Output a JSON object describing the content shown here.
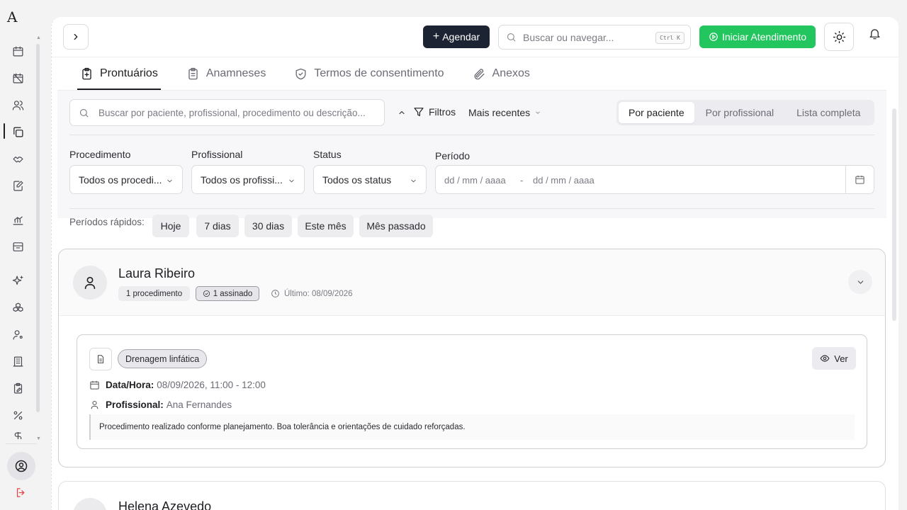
{
  "sidebar": {
    "logo": "A",
    "icons": [
      "calendar-icon",
      "calendar-off-icon",
      "users-icon",
      "copy-files-icon",
      "handshake-icon",
      "edit-document-icon",
      "chart-icon",
      "inbox-icon",
      "sparkles-icon",
      "boxes-icon",
      "user-settings-icon",
      "building-icon",
      "clipboard-edit-icon",
      "percent-icon",
      "dollar-icon"
    ],
    "active": "copy-files-icon"
  },
  "topbar": {
    "agendar_label": "Agendar",
    "search_placeholder": "Buscar ou navegar...",
    "search_shortcut": "Ctrl K",
    "iniciar_label": "Iniciar Atendimento"
  },
  "tabs": [
    {
      "label": "Prontuários",
      "icon": "clipboard-plus-icon",
      "active": true
    },
    {
      "label": "Anamneses",
      "icon": "clipboard-list-icon",
      "active": false
    },
    {
      "label": "Termos de consentimento",
      "icon": "shield-check-icon",
      "active": false
    },
    {
      "label": "Anexos",
      "icon": "paperclip-icon",
      "active": false
    }
  ],
  "filters": {
    "search_placeholder": "Buscar por paciente, profissional, procedimento ou descrição...",
    "filtros_label": "Filtros",
    "sort_label": "Mais recentes",
    "view_modes": [
      "Por paciente",
      "Por profissional",
      "Lista completa"
    ],
    "view_active": "Por paciente",
    "procedimento_label": "Procedimento",
    "procedimento_value": "Todos os procedi...",
    "profissional_label": "Profissional",
    "profissional_value": "Todos os profissi...",
    "status_label": "Status",
    "status_value": "Todos os status",
    "periodo_label": "Período",
    "date_from_placeholder": "dd / mm / aaaa",
    "date_sep": "-",
    "date_to_placeholder": "dd / mm / aaaa",
    "quick_label": "Períodos rápidos:",
    "quick_periods": [
      "Hoje",
      "7 dias",
      "30 dias",
      "Este mês",
      "Mês passado"
    ]
  },
  "patients": [
    {
      "name": "Laura Ribeiro",
      "procedures_badge": "1 procedimento",
      "signed_badge": "1 assinado",
      "last": "Último: 08/09/2026",
      "record": {
        "procedure": "Drenagem linfática",
        "ver_label": "Ver",
        "datetime_key": "Data/Hora:",
        "datetime_value": "08/09/2026, 11:00 - 12:00",
        "prof_key": "Profissional:",
        "prof_value": "Ana Fernandes",
        "note": "Procedimento realizado conforme planejamento. Boa tolerância e orientações de cuidado reforçadas."
      }
    },
    {
      "name": "Helena Azevedo"
    }
  ],
  "colors": {
    "primary_dark": "#1c2333",
    "success": "#22c55e",
    "logout": "#e04848"
  }
}
